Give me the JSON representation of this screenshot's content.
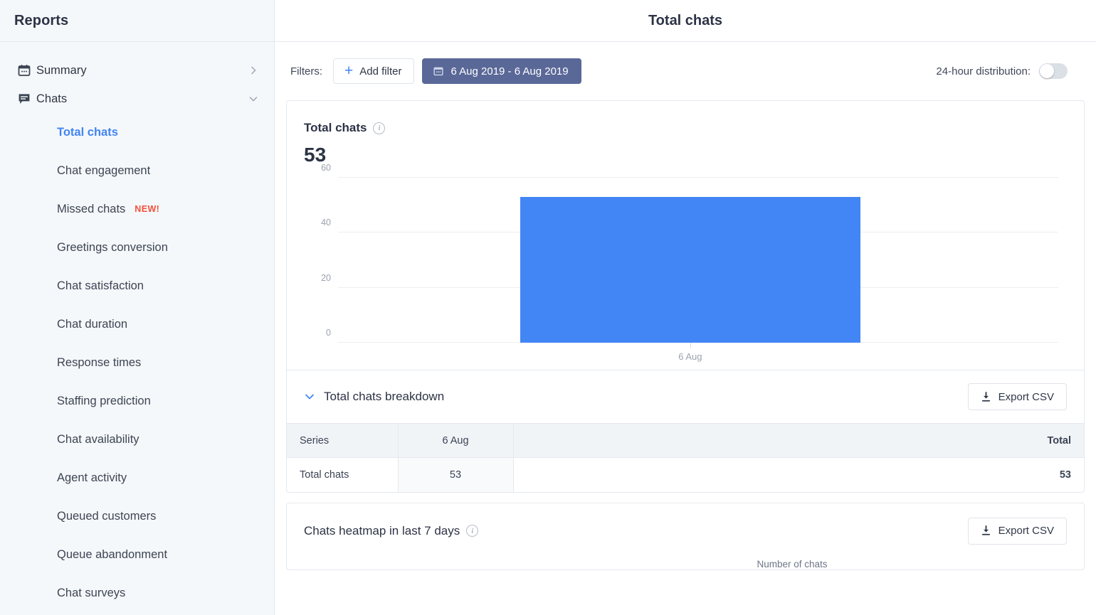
{
  "sidebar": {
    "title": "Reports",
    "groups": [
      {
        "label": "Summary",
        "icon": "calendar-icon",
        "chevron": "chevron-right-icon"
      },
      {
        "label": "Chats",
        "icon": "chat-bubble-icon",
        "chevron": "chevron-down-icon"
      }
    ],
    "items": [
      {
        "label": "Total chats",
        "active": true,
        "badge": ""
      },
      {
        "label": "Chat engagement",
        "active": false,
        "badge": ""
      },
      {
        "label": "Missed chats",
        "active": false,
        "badge": "NEW!"
      },
      {
        "label": "Greetings conversion",
        "active": false,
        "badge": ""
      },
      {
        "label": "Chat satisfaction",
        "active": false,
        "badge": ""
      },
      {
        "label": "Chat duration",
        "active": false,
        "badge": ""
      },
      {
        "label": "Response times",
        "active": false,
        "badge": ""
      },
      {
        "label": "Staffing prediction",
        "active": false,
        "badge": ""
      },
      {
        "label": "Chat availability",
        "active": false,
        "badge": ""
      },
      {
        "label": "Agent activity",
        "active": false,
        "badge": ""
      },
      {
        "label": "Queued customers",
        "active": false,
        "badge": ""
      },
      {
        "label": "Queue abandonment",
        "active": false,
        "badge": ""
      },
      {
        "label": "Chat surveys",
        "active": false,
        "badge": ""
      }
    ]
  },
  "header": {
    "title": "Total chats"
  },
  "filters": {
    "label": "Filters:",
    "add_filter_label": "Add filter",
    "date_range_label": "6 Aug 2019 - 6 Aug 2019",
    "distribution_label": "24-hour distribution:",
    "distribution_on": false
  },
  "chart_card": {
    "title": "Total chats",
    "value": "53"
  },
  "chart_data": {
    "type": "bar",
    "title": "Total chats",
    "categories": [
      "6 Aug"
    ],
    "values": [
      53
    ],
    "series": [
      {
        "name": "Total chats",
        "values": [
          53
        ]
      }
    ],
    "xlabel": "",
    "ylabel": "",
    "ylim": [
      0,
      60
    ],
    "yticks": [
      0,
      20,
      40,
      60
    ],
    "grid": true,
    "legend": "none",
    "bar_color": "#4285f4"
  },
  "breakdown": {
    "title": "Total chats breakdown",
    "export_label": "Export CSV",
    "expanded": true,
    "columns": [
      "Series",
      "6 Aug",
      "",
      "Total"
    ],
    "rows": [
      {
        "series": "Total chats",
        "values": [
          "53"
        ],
        "total": "53"
      }
    ]
  },
  "heatmap": {
    "title": "Chats heatmap in last 7 days",
    "export_label": "Export CSV",
    "legend_label": "Number of chats"
  },
  "colors": {
    "accent_blue": "#4285f4",
    "date_button": "#5a6898",
    "badge_red": "#f4503c",
    "sidebar_bg": "#f5f8fa"
  }
}
